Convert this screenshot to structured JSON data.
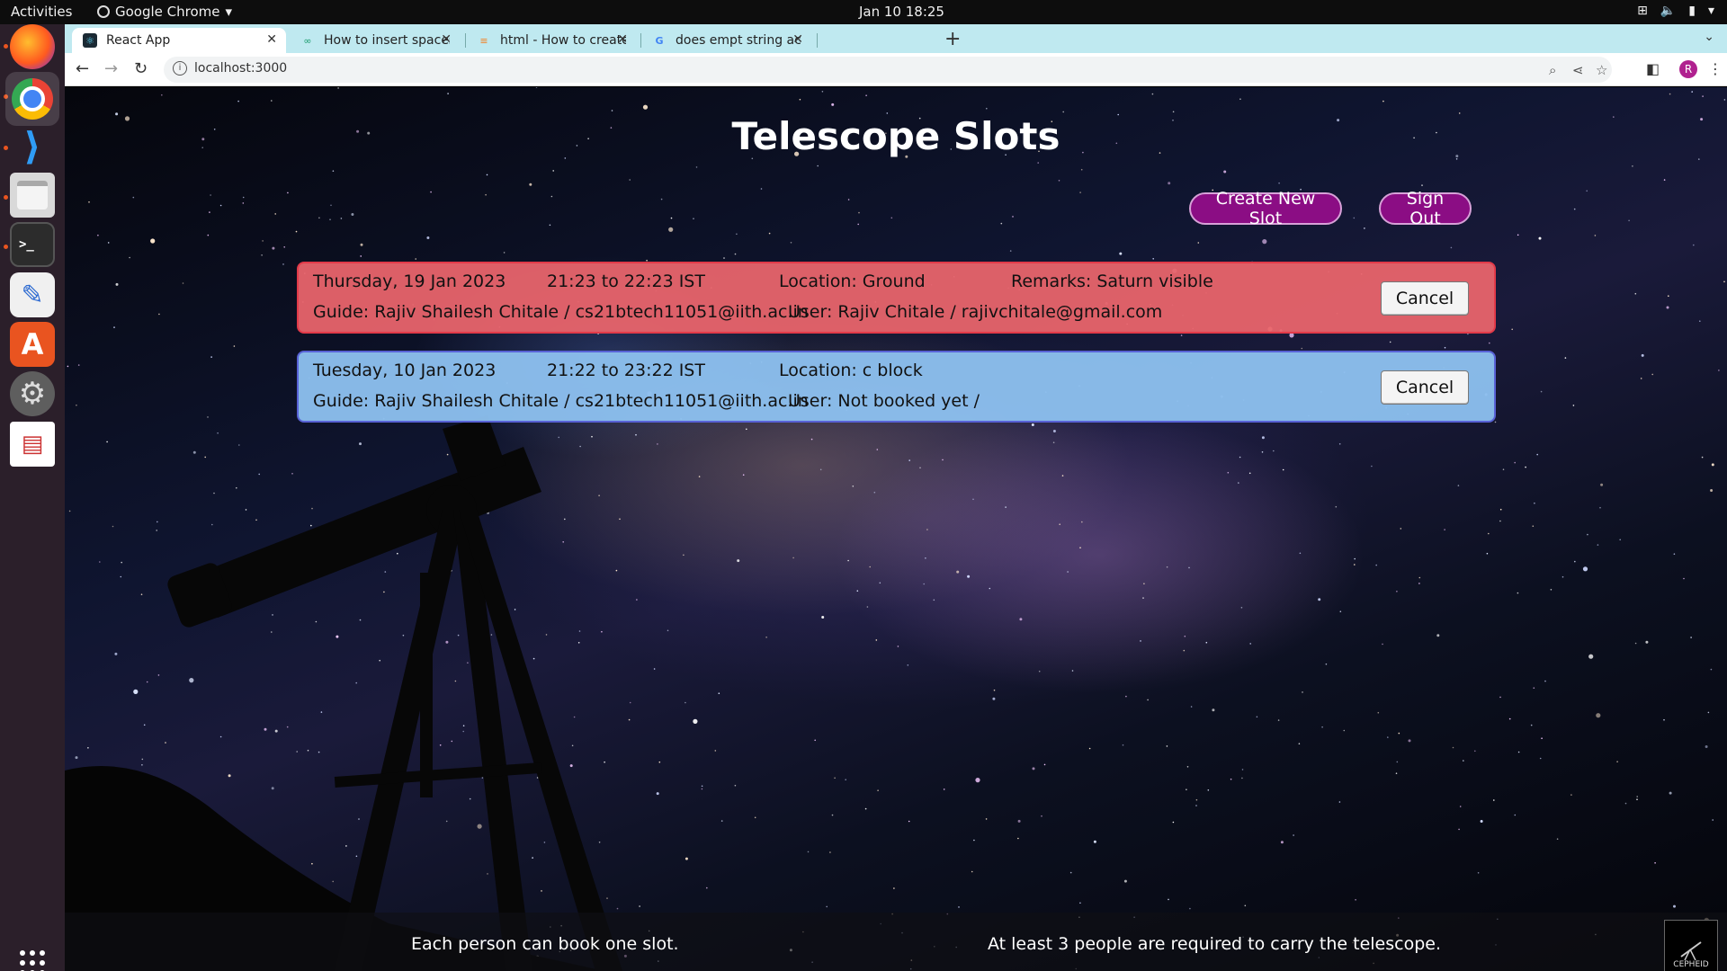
{
  "topbar": {
    "activities": "Activities",
    "app_name": "Google Chrome",
    "clock": "Jan 10  18:25"
  },
  "dock": {
    "items": [
      {
        "name": "firefox",
        "icon": "firefox-icon"
      },
      {
        "name": "chrome",
        "icon": "chrome-icon"
      },
      {
        "name": "vscode",
        "icon": "vscode-icon"
      },
      {
        "name": "files",
        "icon": "files-icon"
      },
      {
        "name": "terminal",
        "icon": "terminal-icon"
      },
      {
        "name": "text-editor",
        "icon": "text-editor-icon"
      },
      {
        "name": "app-center",
        "icon": "app-store-icon"
      },
      {
        "name": "settings",
        "icon": "settings-gear-icon"
      },
      {
        "name": "document-viewer",
        "icon": "document-viewer-icon"
      }
    ]
  },
  "browser": {
    "tabs": [
      {
        "title": "React App",
        "active": true
      },
      {
        "title": "How to insert spaces/tab",
        "active": false
      },
      {
        "title": "html - How to create a ma",
        "active": false
      },
      {
        "title": "does empt string act as n",
        "active": false
      }
    ],
    "url": "localhost:3000",
    "profile_initial": "R"
  },
  "page": {
    "title": "Telescope Slots",
    "create_button": "Create New Slot",
    "signout_button": "Sign Out",
    "slots": [
      {
        "date": "Thursday, 19 Jan 2023",
        "time": "21:23 to 22:23 IST",
        "location": "Location: Ground",
        "remarks": "Remarks: Saturn visible",
        "guide": "Guide: Rajiv Shailesh Chitale / cs21btech11051@iith.ac.in",
        "user": "User: Rajiv Chitale / rajivchitale@gmail.com",
        "cancel": "Cancel",
        "color": "#e8646c"
      },
      {
        "date": "Tuesday, 10 Jan 2023",
        "time": "21:22 to 23:22 IST",
        "location": "Location: c block",
        "remarks": "",
        "guide": "Guide: Rajiv Shailesh Chitale / cs21btech11051@iith.ac.in",
        "user": "User: Not booked yet /",
        "cancel": "Cancel",
        "color": "#8cc0ee"
      }
    ],
    "footer": {
      "note_left": "Each person can book one slot.",
      "note_right": "At least 3 people are required to carry the telescope.",
      "logo_text": "CEPHEID"
    },
    "accent_color": "#8b0d84"
  }
}
